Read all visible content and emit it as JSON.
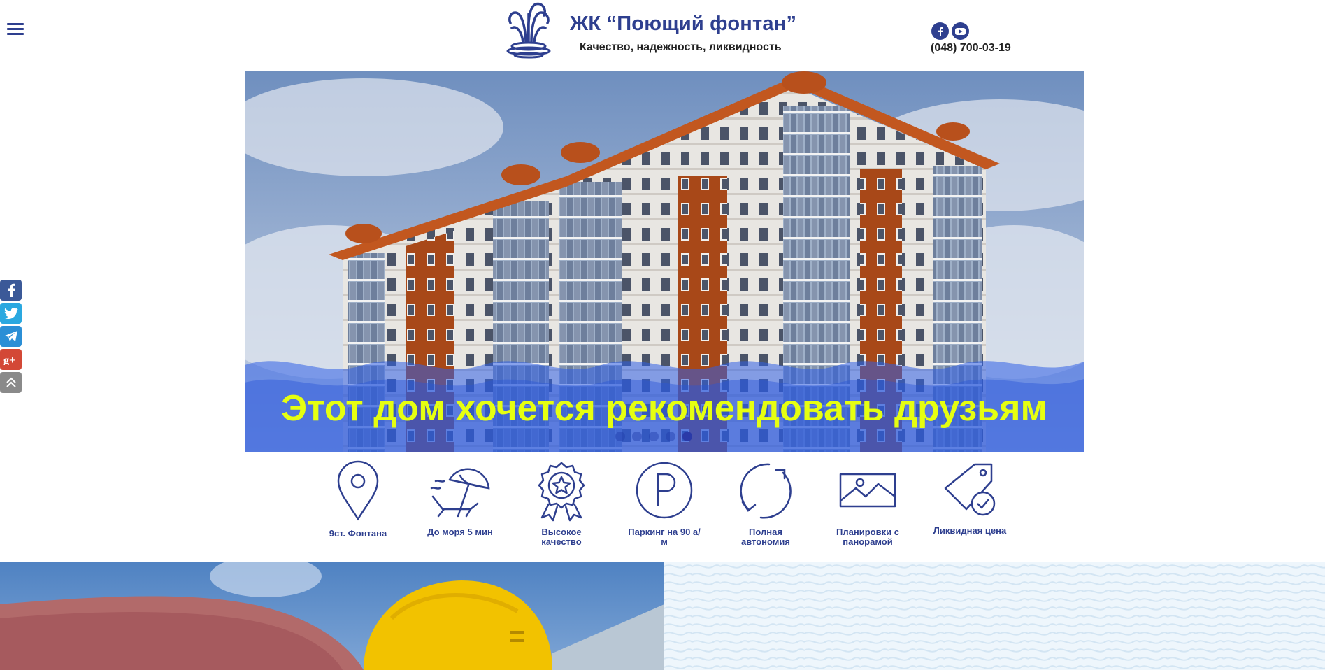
{
  "header": {
    "menu_icon": "hamburger-menu-icon",
    "logo_icon": "fountain-logo-icon",
    "title": "ЖК “Поющий фонтан”",
    "tagline": "Качество, надежность, ликвидность",
    "social": [
      {
        "icon": "facebook-icon"
      },
      {
        "icon": "youtube-icon"
      }
    ],
    "phone": "(048) 700-03-19"
  },
  "hero": {
    "caption": "Этот дом хочется рекомендовать друзьям",
    "slides_count": 5,
    "active_slide": 5,
    "caption_color": "#e6ff10",
    "wave_color": "#3a64e0"
  },
  "share": [
    {
      "icon": "facebook-share-icon",
      "color": "#3b5998"
    },
    {
      "icon": "twitter-share-icon",
      "color": "#2aa8e0"
    },
    {
      "icon": "telegram-share-icon",
      "color": "#2b8fd6"
    },
    {
      "icon": "google-plus-share-icon",
      "color": "#d34836"
    },
    {
      "icon": "scroll-to-top-icon",
      "color": "#8a8a8a"
    }
  ],
  "features": [
    {
      "icon": "location-pin-icon",
      "label": "9ст. Фонтана"
    },
    {
      "icon": "beach-umbrella-icon",
      "label": "До моря 5 мин"
    },
    {
      "icon": "quality-badge-icon",
      "label": "Высокое качество"
    },
    {
      "icon": "parking-icon",
      "label": "Паркинг на 90 а/м"
    },
    {
      "icon": "autonomy-cycle-icon",
      "label": "Полная автономия"
    },
    {
      "icon": "panorama-image-icon",
      "label": "Планировки с панорамой"
    },
    {
      "icon": "price-tag-icon",
      "label": "Ликвидная цена"
    }
  ],
  "colors": {
    "brand": "#2e3f8f",
    "text_dark": "#222222"
  }
}
